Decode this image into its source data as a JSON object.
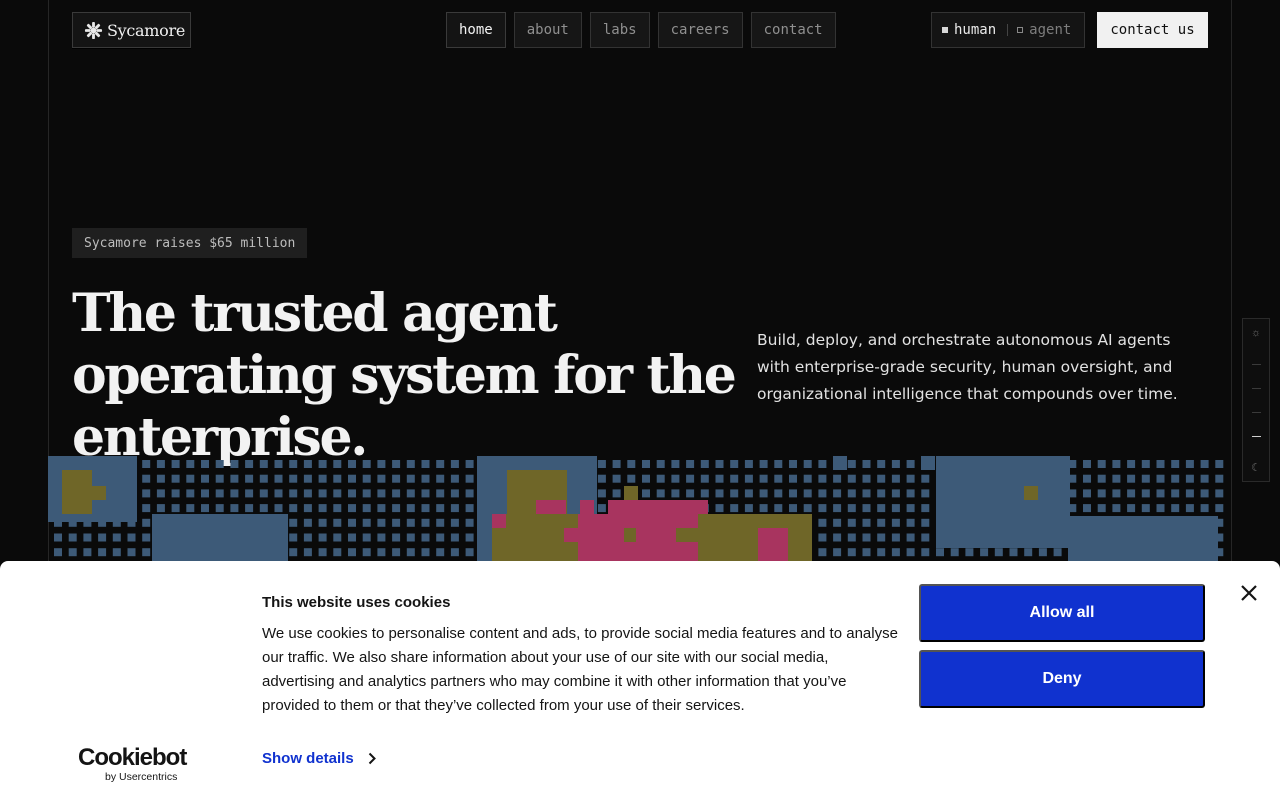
{
  "header": {
    "logo": {
      "text": "Sycamore",
      "icon": "sycamore-logo-icon"
    },
    "nav": [
      {
        "label": "home",
        "active": true
      },
      {
        "label": "about",
        "active": false
      },
      {
        "label": "labs",
        "active": false
      },
      {
        "label": "careers",
        "active": false
      },
      {
        "label": "contact",
        "active": false
      }
    ],
    "mode_toggle": {
      "human": "human",
      "agent": "agent",
      "selected": "human"
    },
    "cta": "contact us"
  },
  "hero": {
    "badge": "Sycamore raises $65 million",
    "headline": "The trusted agent operating system for the enterprise.",
    "subheadline": "Build, deploy, and orchestrate autonomous AI agents with enterprise-grade security, human oversight, and organizational intelligence that compounds over time."
  },
  "theme_rail": {
    "icons": [
      "sun-icon",
      "moon-icon"
    ]
  },
  "cookie_banner": {
    "title": "This website uses cookies",
    "body": "We use cookies to personalise content and ads, to provide social media features and to analyse our traffic. We also share information about your use of our site with our social media, advertising and analytics partners who may combine it with other information that you’ve provided to them or that they’ve collected from your use of their services.",
    "show_details": "Show details",
    "allow_all": "Allow all",
    "deny": "Deny",
    "brand": "Cookiebot",
    "brand_sub": "by Usercentrics"
  },
  "colors": {
    "background": "#0a0a0a",
    "accent_blue": "#1032cf",
    "map_ocean": "#3d5a78",
    "map_land": "#6f6628",
    "map_highlight": "#a8345f"
  }
}
